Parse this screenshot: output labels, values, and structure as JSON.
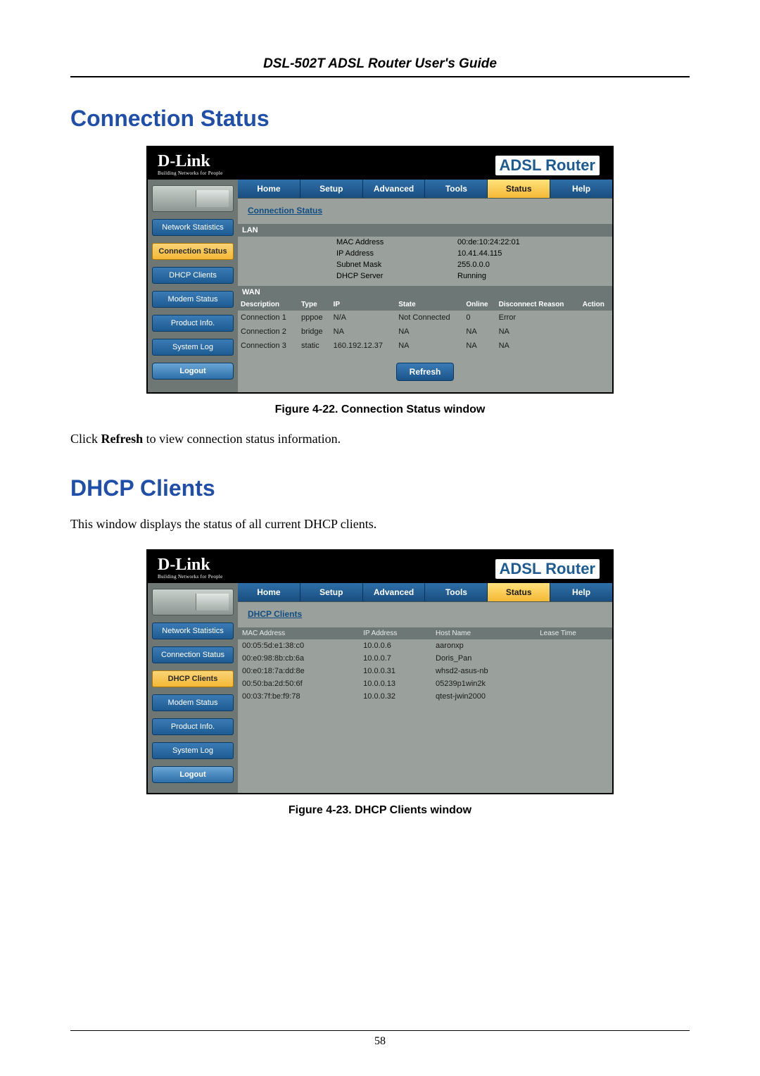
{
  "doc": {
    "header": "DSL-502T ADSL Router User's Guide",
    "page_number": "58",
    "section1_title": "Connection Status",
    "section2_title": "DHCP Clients",
    "body1_a": "Click ",
    "body1_b": "Refresh",
    "body1_c": " to view connection status information.",
    "body2": "This window displays the status of all current DHCP clients.",
    "caption1": "Figure 4-22. Connection Status window",
    "caption2": "Figure 4-23. DHCP Clients window"
  },
  "dlink": {
    "brand": "D-Link",
    "brand_sub": "Building Networks for People",
    "product": "ADSL Router",
    "tabs": [
      "Home",
      "Setup",
      "Advanced",
      "Tools",
      "Status",
      "Help"
    ],
    "sidebar": [
      "Network Statistics",
      "Connection Status",
      "DHCP Clients",
      "Modem Status",
      "Product Info.",
      "System Log",
      "Logout"
    ]
  },
  "conn": {
    "title": "Connection Status",
    "lan_header": "LAN",
    "lan": {
      "mac_k": "MAC Address",
      "mac_v": "00:de:10:24:22:01",
      "ip_k": "IP Address",
      "ip_v": "10.41.44.115",
      "mask_k": "Subnet Mask",
      "mask_v": "255.0.0.0",
      "dhcp_k": "DHCP Server",
      "dhcp_v": "Running"
    },
    "wan_header": "WAN",
    "wan_cols": [
      "Description",
      "Type",
      "IP",
      "State",
      "Online",
      "Disconnect Reason",
      "Action"
    ],
    "wan_rows": [
      {
        "desc": "Connection 1",
        "type": "pppoe",
        "ip": "N/A",
        "state": "Not Connected",
        "online": "0",
        "reason": "Error",
        "action": ""
      },
      {
        "desc": "Connection 2",
        "type": "bridge",
        "ip": "NA",
        "state": "NA",
        "online": "NA",
        "reason": "NA",
        "action": ""
      },
      {
        "desc": "Connection 3",
        "type": "static",
        "ip": "160.192.12.37",
        "state": "NA",
        "online": "NA",
        "reason": "NA",
        "action": ""
      }
    ],
    "refresh": "Refresh"
  },
  "dhcp": {
    "title": "DHCP Clients",
    "cols": [
      "MAC Address",
      "IP Address",
      "Host Name",
      "Lease Time"
    ],
    "rows": [
      {
        "mac": "00:05:5d:e1:38:c0",
        "ip": "10.0.0.6",
        "host": "aaronxp",
        "lease": ""
      },
      {
        "mac": "00:e0:98:8b:cb:6a",
        "ip": "10.0.0.7",
        "host": "Doris_Pan",
        "lease": ""
      },
      {
        "mac": "00:e0:18:7a:dd:8e",
        "ip": "10.0.0.31",
        "host": "whsd2-asus-nb",
        "lease": ""
      },
      {
        "mac": "00:50:ba:2d:50:6f",
        "ip": "10.0.0.13",
        "host": "05239p1win2k",
        "lease": ""
      },
      {
        "mac": "00:03:7f:be:f9:78",
        "ip": "10.0.0.32",
        "host": "qtest-jwin2000",
        "lease": ""
      }
    ]
  }
}
